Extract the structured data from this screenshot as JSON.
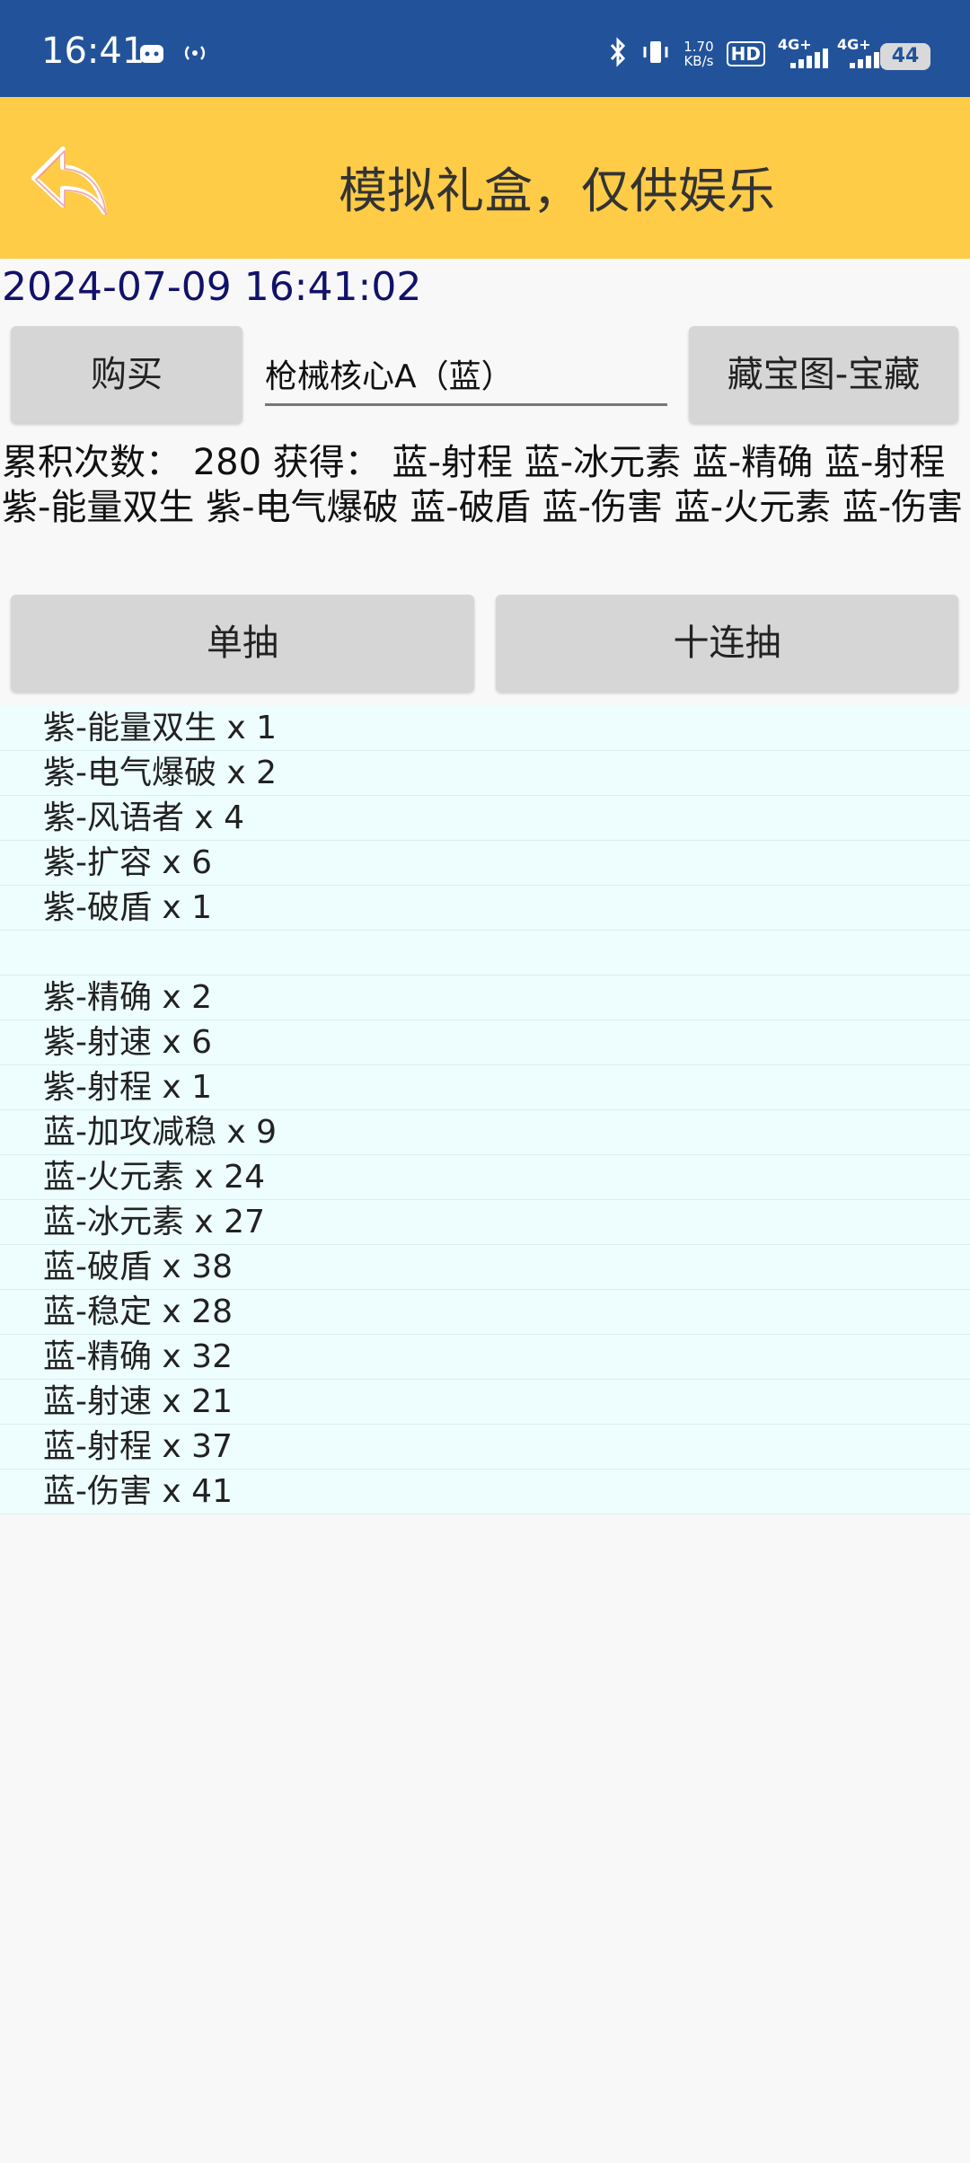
{
  "status_bar": {
    "time": "16:41",
    "speed_value": "1.70",
    "speed_unit": "KB/s",
    "hd_label": "HD",
    "network_1": "4G+",
    "network_2": "4G+",
    "battery": "44"
  },
  "header": {
    "title": "模拟礼盒，仅供娱乐"
  },
  "datetime": "2024-07-09 16:41:02",
  "controls": {
    "buy_label": "购买",
    "item_value": "枪械核心A（蓝）",
    "treasure_map_label": "藏宝图-宝藏",
    "single_draw_label": "单抽",
    "ten_draw_label": "十连抽"
  },
  "summary": {
    "text": "累积次数： 280 获得：  蓝-射程 蓝-冰元素 蓝-精确 蓝-射程 紫-能量双生 紫-电气爆破 蓝-破盾 蓝-伤害 蓝-火元素 蓝-伤害"
  },
  "results": [
    "紫-能量双生 x 1",
    "紫-电气爆破 x 2",
    "紫-风语者 x 4",
    "紫-扩容 x 6",
    "紫-破盾 x 1",
    "",
    "紫-精确 x 2",
    "紫-射速 x 6",
    "紫-射程 x 1",
    "蓝-加攻减稳 x 9",
    "蓝-火元素 x 24",
    "蓝-冰元素 x 27",
    "蓝-破盾 x 38",
    "蓝-稳定 x 28",
    "蓝-精确 x 32",
    "蓝-射速 x 21",
    "蓝-射程 x 37",
    "蓝-伤害 x 41"
  ]
}
